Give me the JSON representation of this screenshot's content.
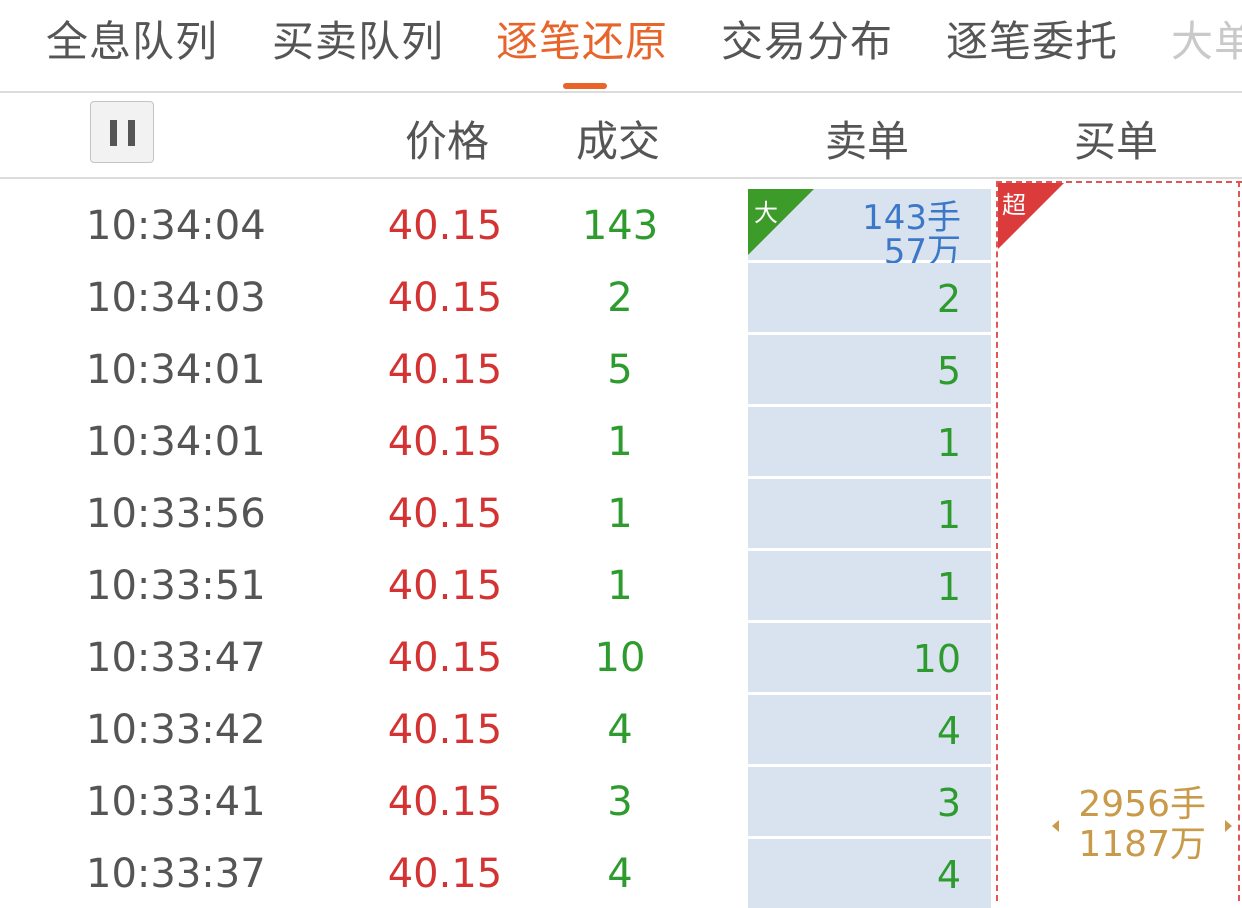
{
  "tabs": [
    "全息队列",
    "买卖队列",
    "逐笔还原",
    "交易分布",
    "逐笔委托",
    "大单"
  ],
  "active_tab": "逐笔还原",
  "headers": {
    "price": "价格",
    "volume": "成交",
    "sell": "卖单",
    "buy": "买单"
  },
  "pause_label": "pause",
  "sell_big": {
    "tag": "大",
    "lots": "143手",
    "amount": "57万"
  },
  "buy_super": {
    "tag": "超",
    "lots": "2956手",
    "amount": "1187万"
  },
  "rows": [
    {
      "time": "10:34:04",
      "price": "40.15",
      "vol": "143",
      "sell": ""
    },
    {
      "time": "10:34:03",
      "price": "40.15",
      "vol": "2",
      "sell": "2"
    },
    {
      "time": "10:34:01",
      "price": "40.15",
      "vol": "5",
      "sell": "5"
    },
    {
      "time": "10:34:01",
      "price": "40.15",
      "vol": "1",
      "sell": "1"
    },
    {
      "time": "10:33:56",
      "price": "40.15",
      "vol": "1",
      "sell": "1"
    },
    {
      "time": "10:33:51",
      "price": "40.15",
      "vol": "1",
      "sell": "1"
    },
    {
      "time": "10:33:47",
      "price": "40.15",
      "vol": "10",
      "sell": "10"
    },
    {
      "time": "10:33:42",
      "price": "40.15",
      "vol": "4",
      "sell": "4"
    },
    {
      "time": "10:33:41",
      "price": "40.15",
      "vol": "3",
      "sell": "3"
    },
    {
      "time": "10:33:37",
      "price": "40.15",
      "vol": "4",
      "sell": "4"
    }
  ],
  "colors": {
    "accent": "#e8642b",
    "up": "#d33333",
    "down": "#2e9b2e",
    "sell_bg": "#d9e3f0",
    "big_order": "#3c78c8",
    "super_order": "#c89a4a"
  }
}
